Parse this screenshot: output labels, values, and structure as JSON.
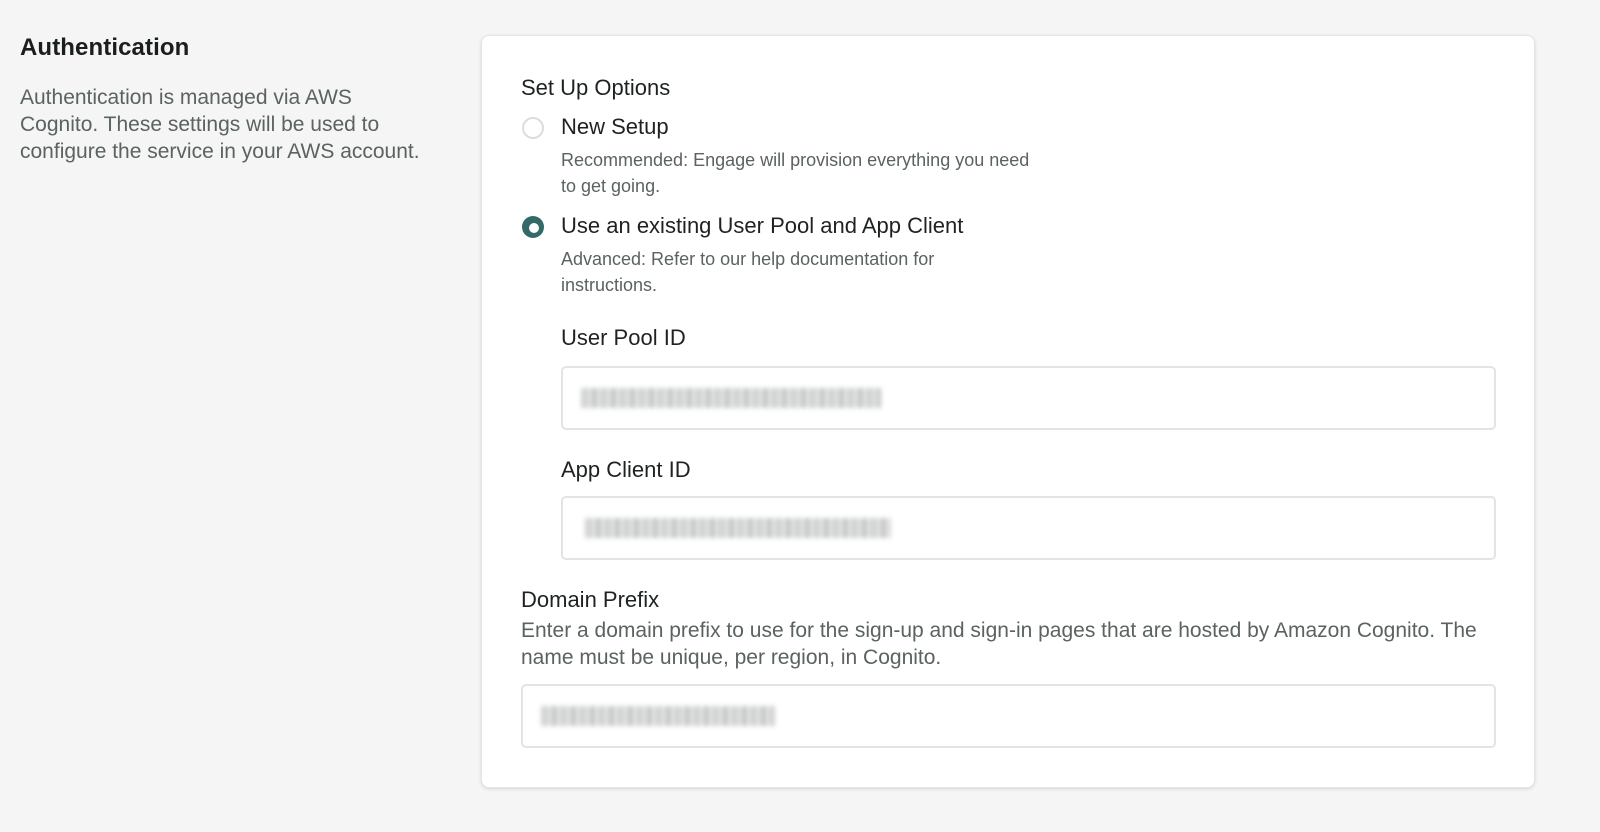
{
  "section": {
    "title": "Authentication",
    "description": "Authentication is managed via AWS Cognito. These settings will be used to configure the service in your AWS account."
  },
  "setup": {
    "heading": "Set Up Options",
    "options": [
      {
        "label": "New Setup",
        "help": "Recommended: Engage will provision everything you need to get going.",
        "selected": false
      },
      {
        "label": "Use an existing User Pool and App Client",
        "help": "Advanced: Refer to our help documentation for instructions.",
        "selected": true
      }
    ]
  },
  "fields": {
    "user_pool_id": {
      "label": "User Pool ID"
    },
    "app_client_id": {
      "label": "App Client ID"
    },
    "domain_prefix": {
      "label": "Domain Prefix",
      "description": "Enter a domain prefix to use for the sign-up and sign-in pages that are hosted by Amazon Cognito. The name must be unique, per region, in Cognito."
    }
  },
  "colors": {
    "accent": "#34696a",
    "background": "#f4f5f4",
    "card": "#ffffff",
    "muted_text": "#5b6262"
  }
}
